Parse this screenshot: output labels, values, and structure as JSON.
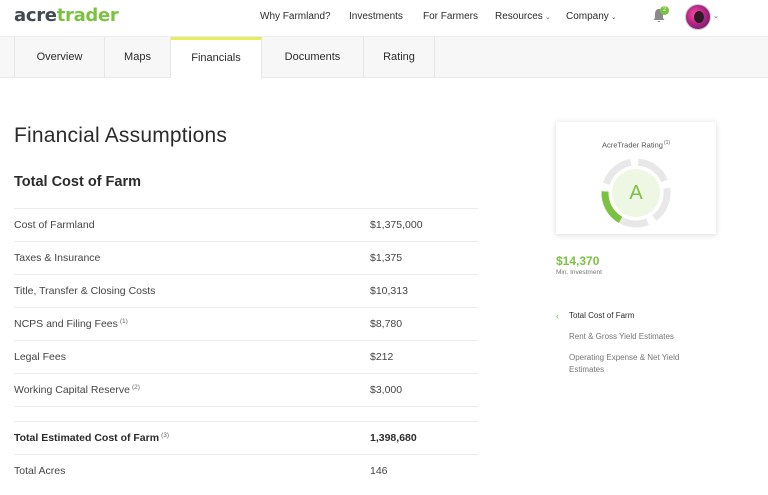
{
  "brand": {
    "part1": "acre",
    "part2": "trader"
  },
  "nav": {
    "items": [
      {
        "label": "Why Farmland?",
        "dropdown": false
      },
      {
        "label": "Investments",
        "dropdown": false
      },
      {
        "label": "For Farmers",
        "dropdown": false
      },
      {
        "label": "Resources",
        "dropdown": true
      },
      {
        "label": "Company",
        "dropdown": true
      }
    ],
    "notification_count": "2"
  },
  "tabs": [
    {
      "label": "Overview",
      "active": false
    },
    {
      "label": "Maps",
      "active": false
    },
    {
      "label": "Financials",
      "active": true
    },
    {
      "label": "Documents",
      "active": false
    },
    {
      "label": "Rating",
      "active": false
    }
  ],
  "main": {
    "title": "Financial Assumptions",
    "section_title": "Total Cost of Farm",
    "rows": [
      {
        "label": "Cost of Farmland",
        "note": "",
        "value": "$1,375,000"
      },
      {
        "label": "Taxes & Insurance",
        "note": "",
        "value": "$1,375"
      },
      {
        "label": "Title, Transfer & Closing Costs",
        "note": "",
        "value": "$10,313"
      },
      {
        "label": "NCPS and Filing Fees",
        "note": "(1)",
        "value": "$8,780"
      },
      {
        "label": "Legal Fees",
        "note": "",
        "value": "$212"
      },
      {
        "label": "Working Capital Reserve",
        "note": "(2)",
        "value": "$3,000"
      }
    ],
    "total": {
      "label": "Total Estimated Cost of Farm",
      "note": "(3)",
      "value": "1,398,680"
    },
    "acres": {
      "label": "Total Acres",
      "value": "146"
    }
  },
  "rating": {
    "title": "AcreTrader Rating",
    "note": "(1)",
    "grade": "A",
    "accent_color": "#7cc242"
  },
  "investment": {
    "amount": "$14,370",
    "label": "Min. Investment"
  },
  "sidenav": [
    {
      "label": "Total Cost of Farm",
      "active": true
    },
    {
      "label": "Rent & Gross Yield Estimates",
      "active": false
    },
    {
      "label": "Operating Expense & Net Yield Estimates",
      "active": false
    }
  ]
}
